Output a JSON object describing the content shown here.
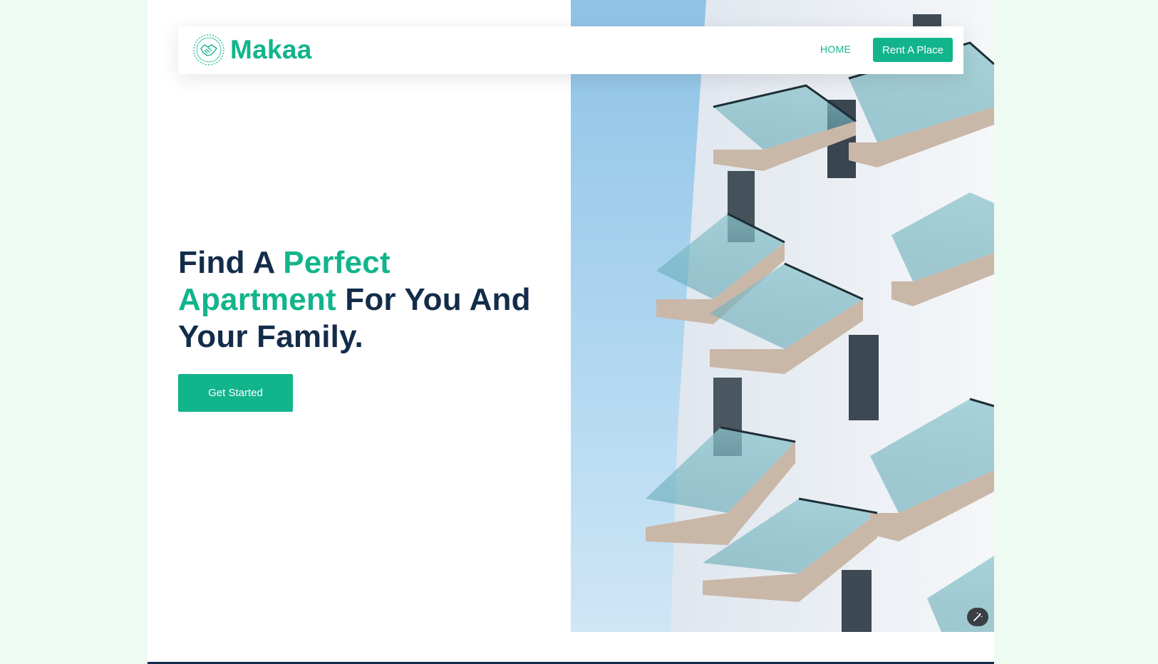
{
  "brand": {
    "name": "Makaa",
    "logo_icon": "handshake-circle-icon"
  },
  "nav": {
    "home_label": "HOME",
    "cta_label": "Rent A Place"
  },
  "hero": {
    "title_part1": "Find A ",
    "title_accent1": "Perfect",
    "title_accent2": "Apartment",
    "title_part2": " For You And Your Family.",
    "cta_label": "Get Started",
    "image_subject": "apartment-building-balconies",
    "image_tool_icon": "magic-wand-icon"
  },
  "colors": {
    "brand_green": "#12b48c",
    "heading_navy": "#132c4a",
    "page_background": "#eefbf2",
    "sky": "#a9d3ee"
  }
}
